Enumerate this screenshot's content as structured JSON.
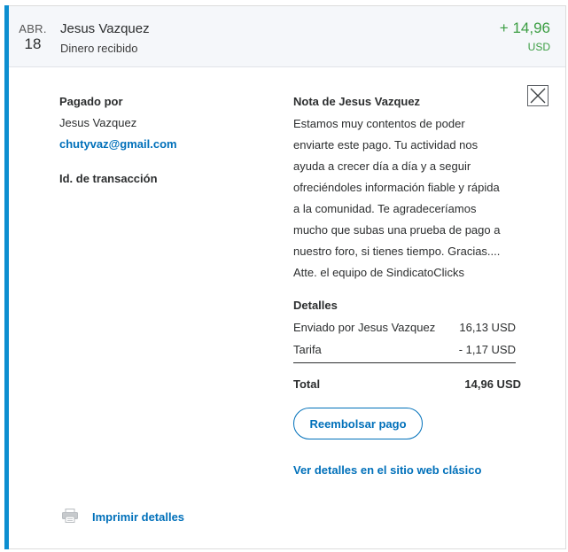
{
  "transaction": {
    "month": "ABR.",
    "day": "18",
    "name": "Jesus Vazquez",
    "type": "Dinero recibido",
    "amount": "+ 14,96",
    "currency": "USD",
    "amount_color": "#3c9e43",
    "accent_color": "#0c8ed0"
  },
  "details": {
    "paid_by_label": "Pagado por",
    "payer_name": "Jesus Vazquez",
    "payer_email": "chutyvaz@gmail.com",
    "transaction_id_label": "Id. de transacción",
    "note_label": "Nota de Jesus Vazquez",
    "note_lines": [
      "Estamos muy contentos de poder",
      "enviarte este pago. Tu actividad nos",
      "ayuda a crecer día a día y a seguir",
      "ofreciéndoles información fiable y rápida",
      "a la comunidad. Te agradeceríamos",
      "mucho que subas una prueba de pago a",
      "nuestro foro, si tienes tiempo. Gracias....",
      "Atte. el equipo de SindicatoClicks"
    ],
    "breakdown_label": "Detalles",
    "sent_by_label": "Enviado por Jesus Vazquez",
    "sent_by_value": "16,13 USD",
    "fee_label": "Tarifa",
    "fee_value": "- 1,17 USD",
    "total_label": "Total",
    "total_value": "14,96 USD"
  },
  "actions": {
    "refund_label": "Reembolsar pago",
    "classic_link": "Ver detalles en el sitio web clásico",
    "print_label": "Imprimir detalles",
    "close_icon": "close-icon",
    "print_icon": "printer-icon",
    "link_color": "#0070ba"
  }
}
